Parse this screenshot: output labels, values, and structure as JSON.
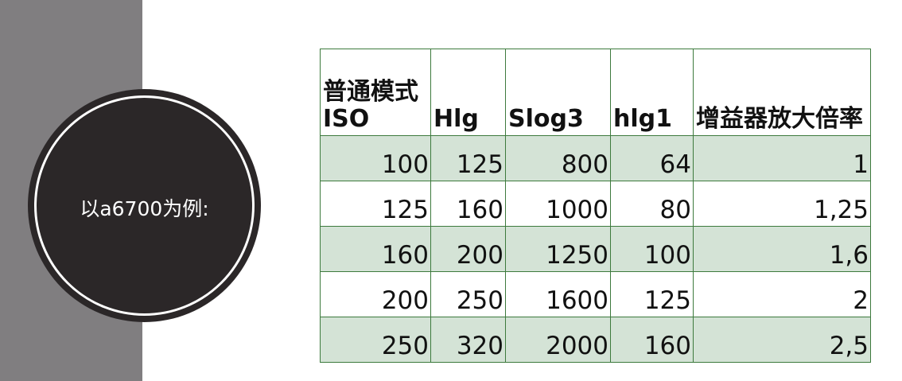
{
  "caption": "以a6700为例:",
  "table": {
    "headers": [
      "普通模式ISO",
      "Hlg",
      "Slog3",
      "hlg1",
      "增益器放大倍率"
    ],
    "rows": [
      [
        "100",
        "125",
        "800",
        "64",
        "1"
      ],
      [
        "125",
        "160",
        "1000",
        "80",
        "1,25"
      ],
      [
        "160",
        "200",
        "1250",
        "100",
        "1,6"
      ],
      [
        "200",
        "250",
        "1600",
        "125",
        "2"
      ],
      [
        "250",
        "320",
        "2000",
        "160",
        "2,5"
      ]
    ]
  },
  "colors": {
    "side_bar": "#807e80",
    "circle": "#2b2728",
    "row_shade": "#d4e3d6",
    "border": "#3d7a3d"
  }
}
